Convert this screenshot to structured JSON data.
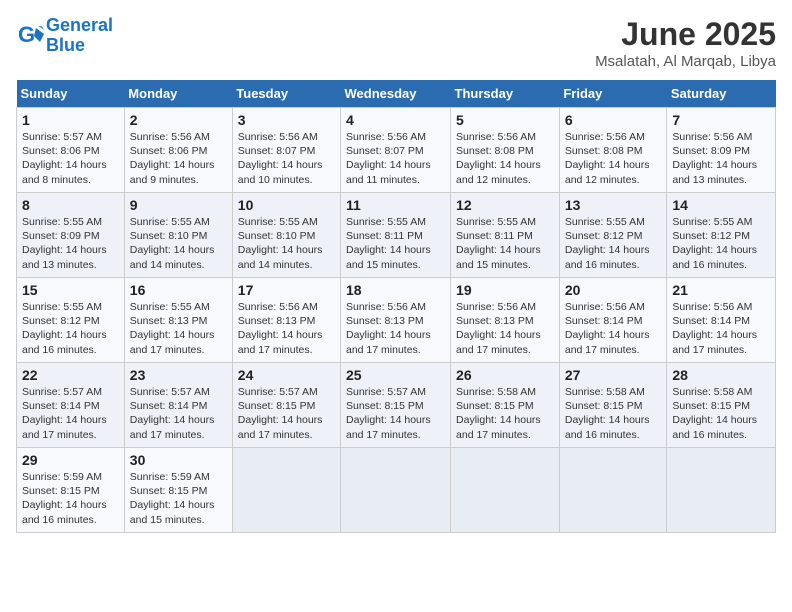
{
  "logo": {
    "line1": "General",
    "line2": "Blue"
  },
  "title": "June 2025",
  "subtitle": "Msalatah, Al Marqab, Libya",
  "weekdays": [
    "Sunday",
    "Monday",
    "Tuesday",
    "Wednesday",
    "Thursday",
    "Friday",
    "Saturday"
  ],
  "weeks": [
    [
      {
        "day": "1",
        "sunrise": "Sunrise: 5:57 AM",
        "sunset": "Sunset: 8:06 PM",
        "daylight": "Daylight: 14 hours and 8 minutes."
      },
      {
        "day": "2",
        "sunrise": "Sunrise: 5:56 AM",
        "sunset": "Sunset: 8:06 PM",
        "daylight": "Daylight: 14 hours and 9 minutes."
      },
      {
        "day": "3",
        "sunrise": "Sunrise: 5:56 AM",
        "sunset": "Sunset: 8:07 PM",
        "daylight": "Daylight: 14 hours and 10 minutes."
      },
      {
        "day": "4",
        "sunrise": "Sunrise: 5:56 AM",
        "sunset": "Sunset: 8:07 PM",
        "daylight": "Daylight: 14 hours and 11 minutes."
      },
      {
        "day": "5",
        "sunrise": "Sunrise: 5:56 AM",
        "sunset": "Sunset: 8:08 PM",
        "daylight": "Daylight: 14 hours and 12 minutes."
      },
      {
        "day": "6",
        "sunrise": "Sunrise: 5:56 AM",
        "sunset": "Sunset: 8:08 PM",
        "daylight": "Daylight: 14 hours and 12 minutes."
      },
      {
        "day": "7",
        "sunrise": "Sunrise: 5:56 AM",
        "sunset": "Sunset: 8:09 PM",
        "daylight": "Daylight: 14 hours and 13 minutes."
      }
    ],
    [
      {
        "day": "8",
        "sunrise": "Sunrise: 5:55 AM",
        "sunset": "Sunset: 8:09 PM",
        "daylight": "Daylight: 14 hours and 13 minutes."
      },
      {
        "day": "9",
        "sunrise": "Sunrise: 5:55 AM",
        "sunset": "Sunset: 8:10 PM",
        "daylight": "Daylight: 14 hours and 14 minutes."
      },
      {
        "day": "10",
        "sunrise": "Sunrise: 5:55 AM",
        "sunset": "Sunset: 8:10 PM",
        "daylight": "Daylight: 14 hours and 14 minutes."
      },
      {
        "day": "11",
        "sunrise": "Sunrise: 5:55 AM",
        "sunset": "Sunset: 8:11 PM",
        "daylight": "Daylight: 14 hours and 15 minutes."
      },
      {
        "day": "12",
        "sunrise": "Sunrise: 5:55 AM",
        "sunset": "Sunset: 8:11 PM",
        "daylight": "Daylight: 14 hours and 15 minutes."
      },
      {
        "day": "13",
        "sunrise": "Sunrise: 5:55 AM",
        "sunset": "Sunset: 8:12 PM",
        "daylight": "Daylight: 14 hours and 16 minutes."
      },
      {
        "day": "14",
        "sunrise": "Sunrise: 5:55 AM",
        "sunset": "Sunset: 8:12 PM",
        "daylight": "Daylight: 14 hours and 16 minutes."
      }
    ],
    [
      {
        "day": "15",
        "sunrise": "Sunrise: 5:55 AM",
        "sunset": "Sunset: 8:12 PM",
        "daylight": "Daylight: 14 hours and 16 minutes."
      },
      {
        "day": "16",
        "sunrise": "Sunrise: 5:55 AM",
        "sunset": "Sunset: 8:13 PM",
        "daylight": "Daylight: 14 hours and 17 minutes."
      },
      {
        "day": "17",
        "sunrise": "Sunrise: 5:56 AM",
        "sunset": "Sunset: 8:13 PM",
        "daylight": "Daylight: 14 hours and 17 minutes."
      },
      {
        "day": "18",
        "sunrise": "Sunrise: 5:56 AM",
        "sunset": "Sunset: 8:13 PM",
        "daylight": "Daylight: 14 hours and 17 minutes."
      },
      {
        "day": "19",
        "sunrise": "Sunrise: 5:56 AM",
        "sunset": "Sunset: 8:13 PM",
        "daylight": "Daylight: 14 hours and 17 minutes."
      },
      {
        "day": "20",
        "sunrise": "Sunrise: 5:56 AM",
        "sunset": "Sunset: 8:14 PM",
        "daylight": "Daylight: 14 hours and 17 minutes."
      },
      {
        "day": "21",
        "sunrise": "Sunrise: 5:56 AM",
        "sunset": "Sunset: 8:14 PM",
        "daylight": "Daylight: 14 hours and 17 minutes."
      }
    ],
    [
      {
        "day": "22",
        "sunrise": "Sunrise: 5:57 AM",
        "sunset": "Sunset: 8:14 PM",
        "daylight": "Daylight: 14 hours and 17 minutes."
      },
      {
        "day": "23",
        "sunrise": "Sunrise: 5:57 AM",
        "sunset": "Sunset: 8:14 PM",
        "daylight": "Daylight: 14 hours and 17 minutes."
      },
      {
        "day": "24",
        "sunrise": "Sunrise: 5:57 AM",
        "sunset": "Sunset: 8:15 PM",
        "daylight": "Daylight: 14 hours and 17 minutes."
      },
      {
        "day": "25",
        "sunrise": "Sunrise: 5:57 AM",
        "sunset": "Sunset: 8:15 PM",
        "daylight": "Daylight: 14 hours and 17 minutes."
      },
      {
        "day": "26",
        "sunrise": "Sunrise: 5:58 AM",
        "sunset": "Sunset: 8:15 PM",
        "daylight": "Daylight: 14 hours and 17 minutes."
      },
      {
        "day": "27",
        "sunrise": "Sunrise: 5:58 AM",
        "sunset": "Sunset: 8:15 PM",
        "daylight": "Daylight: 14 hours and 16 minutes."
      },
      {
        "day": "28",
        "sunrise": "Sunrise: 5:58 AM",
        "sunset": "Sunset: 8:15 PM",
        "daylight": "Daylight: 14 hours and 16 minutes."
      }
    ],
    [
      {
        "day": "29",
        "sunrise": "Sunrise: 5:59 AM",
        "sunset": "Sunset: 8:15 PM",
        "daylight": "Daylight: 14 hours and 16 minutes."
      },
      {
        "day": "30",
        "sunrise": "Sunrise: 5:59 AM",
        "sunset": "Sunset: 8:15 PM",
        "daylight": "Daylight: 14 hours and 15 minutes."
      },
      null,
      null,
      null,
      null,
      null
    ]
  ]
}
